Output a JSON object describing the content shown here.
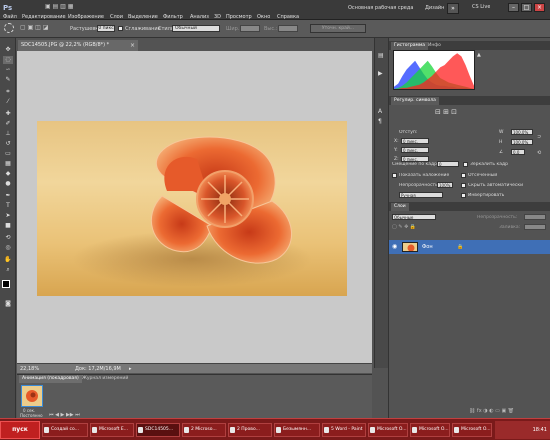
{
  "appbar": {
    "logo": "Ps",
    "menu": [
      "Файл",
      "Редактирование",
      "Изображение",
      "Слои",
      "Выделение",
      "Фильтр",
      "Анализ",
      "3D",
      "Просмотр",
      "Окно",
      "Справка"
    ],
    "workspace": "Основная рабочая среда",
    "design": "Дизайн",
    "workspace_more": "»",
    "cslive": "CS Live",
    "window_buttons": [
      "–",
      "□",
      "×"
    ]
  },
  "options": {
    "feather_label": "Растушевка:",
    "feather_value": "0 пикс",
    "antialias_label": "Сглаживание",
    "style_label": "Стиль:",
    "style_value": "Обычный",
    "width_label": "Шир.:",
    "height_label": "Выс.:",
    "refine_button": "Уточн. край..."
  },
  "document": {
    "tab_title": "SDC14505.JPG @ 22,2% (RGB/8*) *",
    "zoom": "22,18%",
    "doc_size": "Док: 17,2M/16,9M"
  },
  "animation": {
    "tab_active": "Анимация (покадровая)",
    "tab_inactive": "Журнал измерений",
    "frame_time": "0 сек.",
    "loop": "Постоянно"
  },
  "histogram": {
    "tab_active": "Гистограмма",
    "tab_inactive": "Инфо"
  },
  "adjust": {
    "tab": "Регулир. символа",
    "indent_label": "Отступ:",
    "value_a": "0 пикс.",
    "value_b": "0 пикс.",
    "value_c": "0 пикс.",
    "pct_1": "100,0%",
    "pct_2": "100,0%",
    "deg": "0,0",
    "offset_label": "Смещение по кадрам:",
    "offset_value": "0",
    "opt_flip": "Зеркалить кадр",
    "opt_show_overlay": "Показать наложение",
    "opt_auto_hide": "Отсеченный",
    "opacity_label": "Непрозрачность:",
    "opacity_value": "100%",
    "opt_autohide": "Скрыть автоматически",
    "mode_value": "Ручная",
    "opt_invert": "Инвертировать"
  },
  "layers": {
    "tab": "Слои",
    "blend_mode": "Обычные",
    "opacity_label": "Непрозрачность:",
    "fill_label": "Заливка:",
    "layer_name": "Фон"
  },
  "taskbar": {
    "start": "пуск",
    "tasks": [
      "Создай со...",
      "Microsoft E...",
      "SDC14505...",
      "2 Microso...",
      "2 Прово...",
      "Безымянн...",
      "5 Word - Paint",
      "Microsoft O...",
      "Microsoft O...",
      "Microsoft O..."
    ],
    "clock": "18:41"
  },
  "colors": {
    "accent": "#3f6fb6",
    "taskbar": "#7a1a1a",
    "flower": "#e8542a"
  },
  "histogram_data": {
    "type": "area",
    "series": [
      {
        "color": "#1e3cff",
        "values": [
          2,
          5,
          12,
          18,
          22,
          26,
          20,
          14,
          9,
          6,
          4,
          3,
          3,
          2,
          2,
          1,
          1,
          1,
          0,
          0
        ]
      },
      {
        "color": "#18d63a",
        "values": [
          0,
          1,
          3,
          6,
          10,
          14,
          18,
          22,
          26,
          21,
          15,
          10,
          8,
          6,
          5,
          4,
          3,
          2,
          1,
          0
        ]
      },
      {
        "color": "#ff2020",
        "values": [
          0,
          0,
          1,
          1,
          2,
          3,
          4,
          6,
          9,
          12,
          16,
          20,
          22,
          26,
          30,
          33,
          30,
          22,
          12,
          3
        ]
      }
    ]
  }
}
